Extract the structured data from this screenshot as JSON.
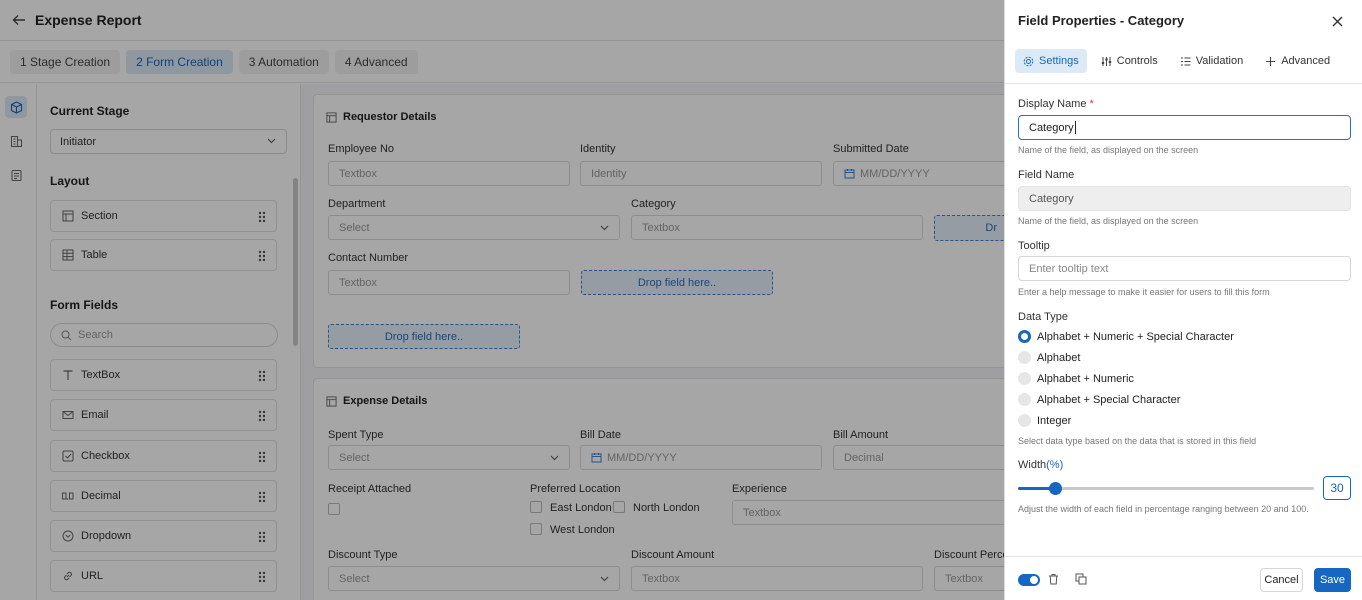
{
  "app": {
    "title": "Expense Report"
  },
  "steps": [
    {
      "label": "1  Stage Creation"
    },
    {
      "label": "2  Form Creation"
    },
    {
      "label": "3  Automation"
    },
    {
      "label": "4  Advanced"
    }
  ],
  "toolpanel": {
    "current_stage_heading": "Current Stage",
    "current_stage_value": "Initiator",
    "layout_heading": "Layout",
    "layout_items": [
      {
        "label": "Section"
      },
      {
        "label": "Table"
      }
    ],
    "form_fields_heading": "Form Fields",
    "search_placeholder": "Search",
    "field_items": [
      {
        "label": "TextBox"
      },
      {
        "label": "Email"
      },
      {
        "label": "Checkbox"
      },
      {
        "label": "Decimal"
      },
      {
        "label": "Dropdown"
      },
      {
        "label": "URL"
      }
    ]
  },
  "canvas": {
    "requestor": {
      "title": "Requestor Details",
      "employee_no_label": "Employee No",
      "employee_no_ph": "Textbox",
      "identity_label": "Identity",
      "identity_ph": "Identity",
      "submitted_date_label": "Submitted Date",
      "submitted_date_ph": "MM/DD/YYYY",
      "department_label": "Department",
      "department_ph": "Select",
      "category_label": "Category",
      "category_ph": "Textbox",
      "contact_label": "Contact Number",
      "contact_ph": "Textbox",
      "drop_text": "Drop field here..",
      "drop_partial": "Dr"
    },
    "expense": {
      "title": "Expense Details",
      "spent_type_label": "Spent Type",
      "spent_type_ph": "Select",
      "bill_date_label": "Bill Date",
      "bill_date_ph": "MM/DD/YYYY",
      "bill_amount_label": "Bill Amount",
      "bill_amount_ph": "Decimal",
      "receipt_label": "Receipt Attached",
      "pref_location_label": "Preferred Location",
      "loc_east": "East London",
      "loc_north": "North London",
      "loc_west": "West London",
      "experience_label": "Experience",
      "experience_ph": "Textbox",
      "discount_type_label": "Discount Type",
      "discount_type_ph": "Select",
      "discount_amount_label": "Discount Amount",
      "discount_amount_ph": "Textbox",
      "discount_perc_label": "Discount Perce",
      "discount_perc_ph": "Textbox"
    }
  },
  "drawer": {
    "title": "Field Properties - Category",
    "tabs": [
      {
        "label": "Settings",
        "icon": "gear-icon"
      },
      {
        "label": "Controls",
        "icon": "sliders-icon"
      },
      {
        "label": "Validation",
        "icon": "list-check-icon"
      },
      {
        "label": "Advanced",
        "icon": "plus-icon"
      }
    ],
    "display_name_label": "Display Name",
    "required_mark": "*",
    "display_name_value": "Category",
    "display_name_help": "Name of the field, as displayed on the screen",
    "field_name_label": "Field Name",
    "field_name_value": "Category",
    "field_name_help": "Name of the field, as displayed on the screen",
    "tooltip_label": "Tooltip",
    "tooltip_placeholder": "Enter tooltip text",
    "tooltip_help": "Enter a help message to make it easier for users to fill this form",
    "data_type_label": "Data Type",
    "data_types": [
      {
        "label": "Alphabet + Numeric + Special Character",
        "selected": true
      },
      {
        "label": "Alphabet",
        "selected": false
      },
      {
        "label": "Alphabet + Numeric",
        "selected": false
      },
      {
        "label": "Alphabet + Special Character",
        "selected": false
      },
      {
        "label": "Integer",
        "selected": false
      }
    ],
    "data_type_help": "Select data type based on the data that is stored in this field",
    "width_label": "Width",
    "width_unit": "(%)",
    "width_value": "30",
    "width_min": 20,
    "width_max": 100,
    "width_help": "Adjust the width of each field in percentage ranging between 20 and 100.",
    "cancel_label": "Cancel",
    "save_label": "Save",
    "accent_color": "#1567c1"
  }
}
